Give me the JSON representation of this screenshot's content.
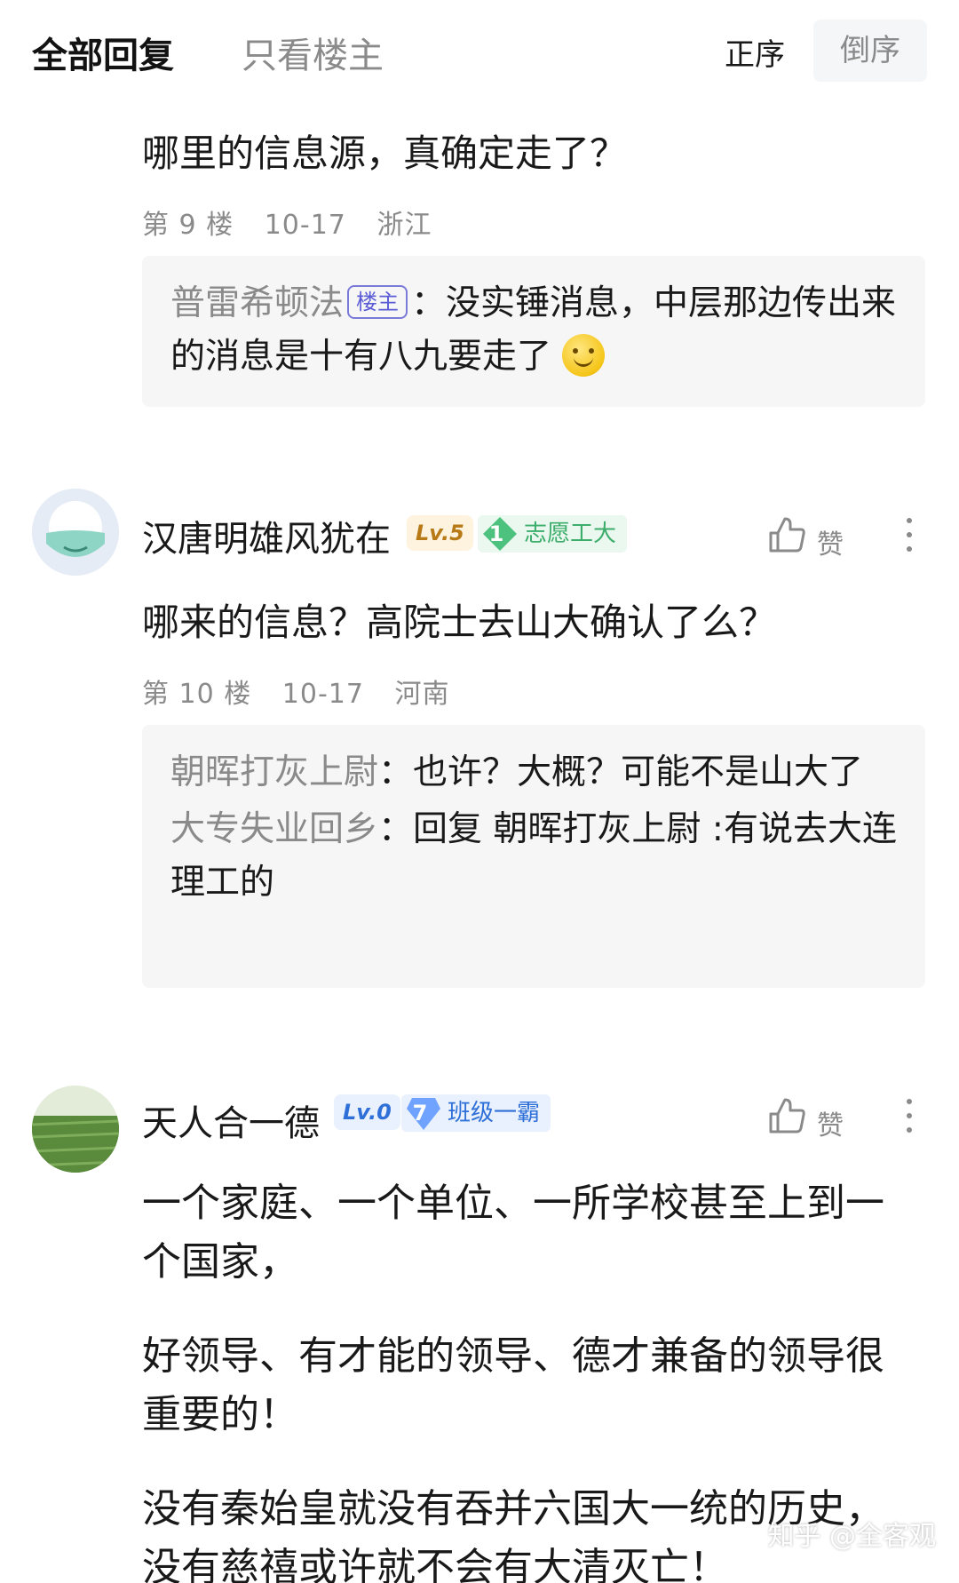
{
  "header": {
    "tab_all": "全部回复",
    "tab_op_only": "只看楼主",
    "sort_asc": "正序",
    "sort_desc": "倒序"
  },
  "comments": [
    {
      "content": "哪里的信息源，真确定走了？",
      "floor": "第 9 楼",
      "date": "10-17",
      "location": "浙江",
      "replies": [
        {
          "name": "普雷希顿法",
          "tag": "楼主",
          "text": "：没实锤消息，中层那边传出来的消息是十有八九要走了",
          "emoji": "smile-emoji"
        }
      ]
    },
    {
      "username": "汉唐明雄风犹在",
      "level": "Lv.5",
      "badge_num": "1",
      "badge_label": "志愿工大",
      "like_label": "赞",
      "content": "哪来的信息？高院士去山大确认了么？",
      "floor": "第 10 楼",
      "date": "10-17",
      "location": "河南",
      "replies": [
        {
          "name": "朝晖打灰上尉",
          "text": "：也许？大概？可能不是山大了"
        },
        {
          "name": "大专失业回乡",
          "text": "：回复 朝晖打灰上尉 :有说去大连理工的"
        }
      ]
    },
    {
      "username": "天人合一德",
      "level": "Lv.0",
      "badge_num": "7",
      "badge_label": "班级一霸",
      "like_label": "赞",
      "paragraphs": [
        "一个家庭、一个单位、一所学校甚至上到一个国家，",
        "好领导、有才能的领导、德才兼备的领导很重要的！",
        "没有秦始皇就没有吞并六国大一统的历史，没有慈禧或许就不会有大清灭亡！"
      ]
    }
  ],
  "watermark": "知乎 @全客观",
  "colors": {
    "text_primary": "#191919",
    "text_secondary": "#8a8a8a",
    "reply_bg": "#f6f6f6",
    "op_tag": "#5b5bd6",
    "level5": "#b87a16",
    "level0": "#2f6fd8",
    "badge_green": "#3cad6a",
    "badge_blue": "#2f6fd8"
  },
  "icons": [
    "thumbs-up-icon",
    "more-vertical-icon",
    "gem-badge-icon",
    "smile-emoji"
  ]
}
